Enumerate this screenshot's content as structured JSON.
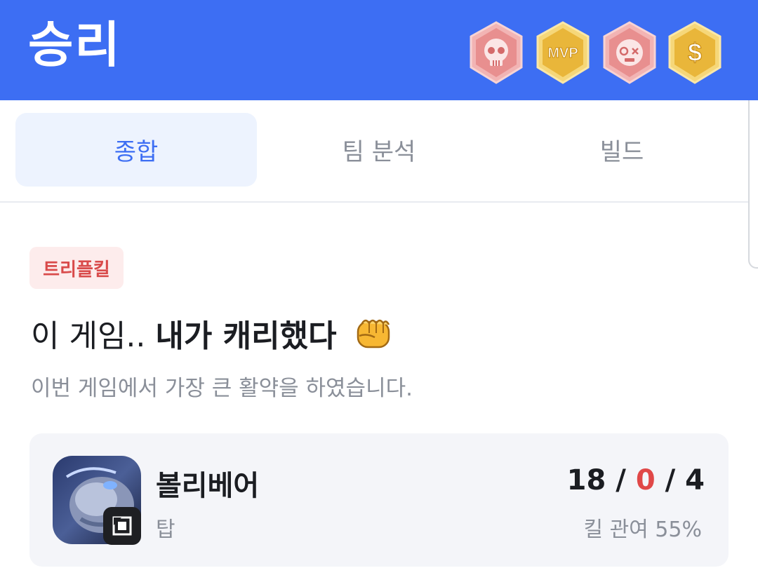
{
  "header": {
    "title": "승리",
    "badges": [
      {
        "icon": "skull-badge-icon",
        "color": "#e88f8f"
      },
      {
        "icon": "mvp-badge-icon",
        "color": "#f0c245",
        "text": "MVP"
      },
      {
        "icon": "zombie-badge-icon",
        "color": "#e88f8f"
      },
      {
        "icon": "dollar-badge-icon",
        "color": "#f0c245",
        "text": "$"
      }
    ]
  },
  "tabs": [
    {
      "label": "종합",
      "active": true
    },
    {
      "label": "팀 분석",
      "active": false
    },
    {
      "label": "빌드",
      "active": false
    }
  ],
  "highlight": {
    "tag": "트리플킬",
    "headline_prefix": "이 게임..",
    "headline_bold": "내가 캐리했다",
    "subtext": "이번 게임에서 가장 큰 활약을 하였습니다."
  },
  "player": {
    "champion": "볼리베어",
    "role": "탑",
    "kills": "18",
    "deaths": "0",
    "assists": "4",
    "sep": "/",
    "kill_participation": "킬 관여 55%"
  },
  "colors": {
    "header_bg": "#3d6ef3",
    "accent": "#3d6ef3",
    "deaths": "#e04848",
    "tag_bg": "#fdecec",
    "tag_text": "#d94b4b"
  }
}
